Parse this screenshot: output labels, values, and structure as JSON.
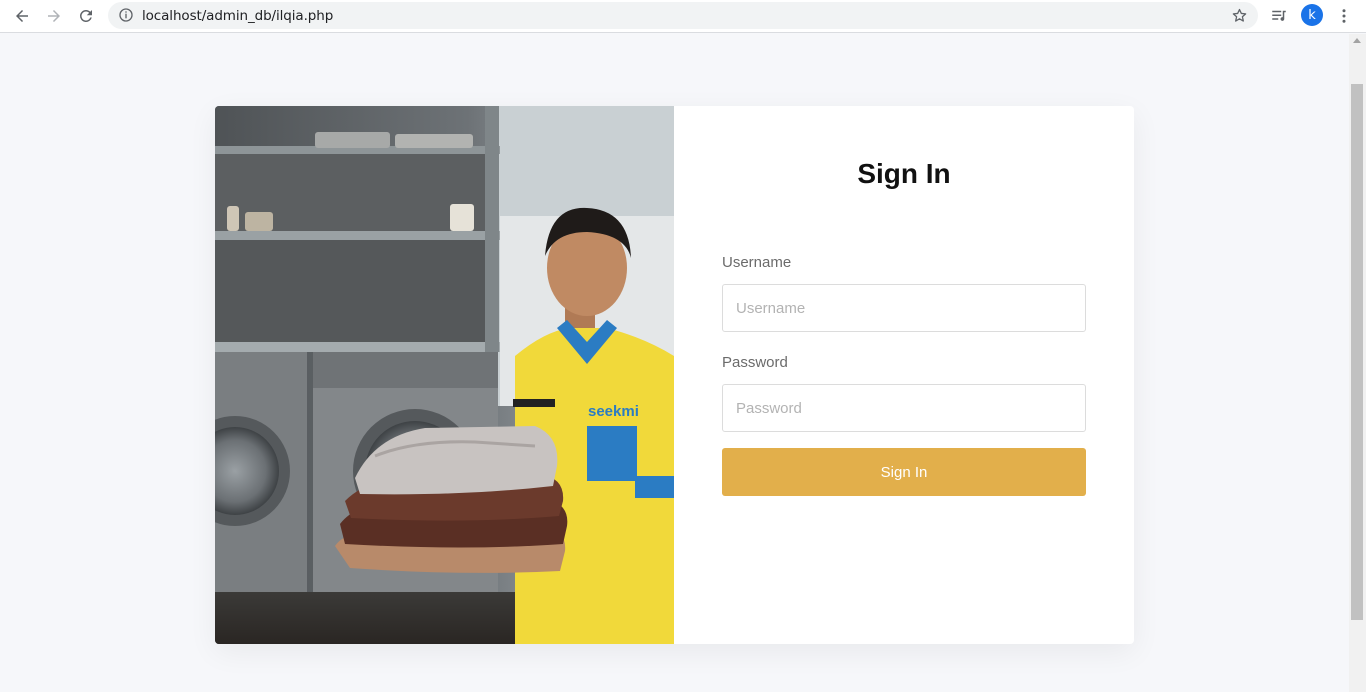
{
  "browser": {
    "url": "localhost/admin_db/ilqia.php",
    "profile_initial": "k"
  },
  "icons": {
    "back": "arrow-left-icon",
    "forward": "arrow-right-icon",
    "reload": "reload-icon",
    "site_info": "info-icon",
    "bookmark": "star-icon",
    "media": "playlist-icon",
    "menu": "kebab-menu-icon"
  },
  "login": {
    "title": "Sign In",
    "username_label": "Username",
    "username_placeholder": "Username",
    "username_value": "",
    "password_label": "Password",
    "password_placeholder": "Password",
    "password_value": "",
    "submit_label": "Sign In"
  },
  "photo": {
    "logo_text": "seekmi"
  },
  "colors": {
    "accent": "#e2af4b",
    "page_bg": "#f6f7fa",
    "profile": "#1a73e8"
  }
}
